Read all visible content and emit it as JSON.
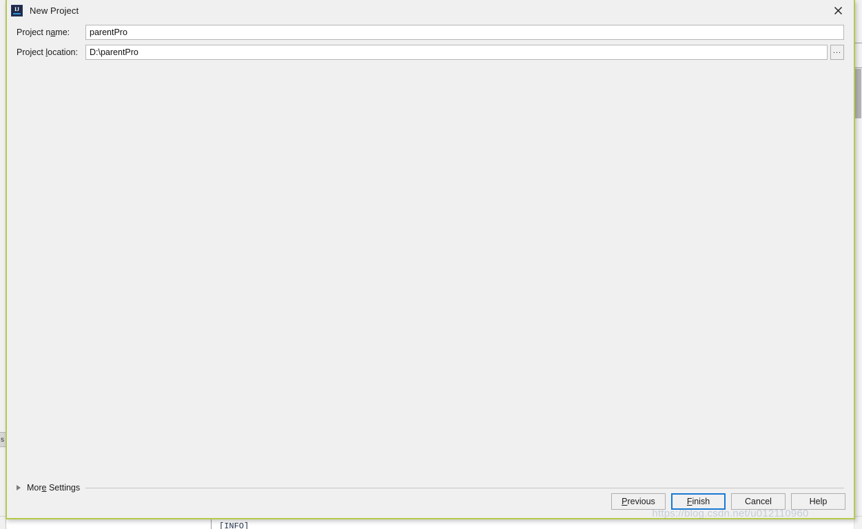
{
  "window": {
    "title": "New Project",
    "icon": "intellij-idea-icon",
    "close_icon": "close-icon",
    "accent_border_color": "#b5c94e",
    "background_color": "#f0f0f0"
  },
  "form": {
    "fields": [
      {
        "id": "project-name",
        "label_before": "Project n",
        "label_mnemonic": "a",
        "label_after": "me:",
        "label_full": "Project name:",
        "value": "parentPro",
        "placeholder": "",
        "has_browse": false
      },
      {
        "id": "project-location",
        "label_before": "Project ",
        "label_mnemonic": "l",
        "label_after": "ocation:",
        "label_full": "Project location:",
        "value": "D:\\parentPro",
        "placeholder": "",
        "has_browse": true,
        "browse_label": "..."
      }
    ]
  },
  "more_settings": {
    "label_before": "Mor",
    "label_mnemonic": "e",
    "label_after": " Settings",
    "label_full": "More Settings",
    "expanded": false,
    "disclosure_icon": "chevron-right-icon"
  },
  "buttons": [
    {
      "id": "previous",
      "label_before": "",
      "label_mnemonic": "P",
      "label_after": "revious",
      "label_full": "Previous",
      "focused": false
    },
    {
      "id": "finish",
      "label_before": "",
      "label_mnemonic": "F",
      "label_after": "inish",
      "label_full": "Finish",
      "focused": true
    },
    {
      "id": "cancel",
      "label_before": "Cancel",
      "label_mnemonic": "",
      "label_after": "",
      "label_full": "Cancel",
      "focused": false
    },
    {
      "id": "help",
      "label_before": "Help",
      "label_mnemonic": "",
      "label_after": "",
      "label_full": "Help",
      "focused": false
    }
  ],
  "focus_color": "#1779d4",
  "background_app": {
    "left_tab_text": "s",
    "console_text": "[INFO]",
    "scrollbar_visible": true
  },
  "watermark": {
    "text": "https://blog.csdn.net/u012110960"
  }
}
